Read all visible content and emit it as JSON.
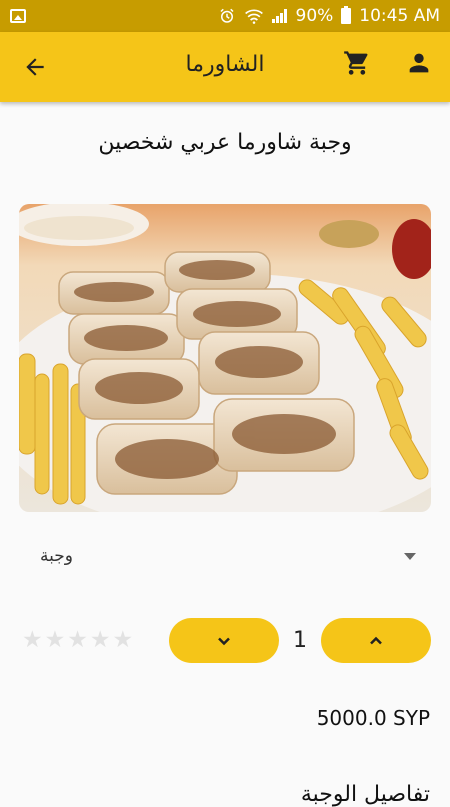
{
  "status_bar": {
    "battery_percent": "90%",
    "time": "10:45 AM",
    "left_icon": "image-icon",
    "icons": [
      "alarm-icon",
      "wifi-icon",
      "signal-icon",
      "battery-icon"
    ]
  },
  "app_bar": {
    "title": "الشاورما",
    "back_icon": "arrow-back-icon",
    "cart_icon": "cart-icon",
    "account_icon": "person-icon",
    "color": "#f5c518"
  },
  "product": {
    "title": "وجبة شاورما عربي شخصين",
    "image_alt": "shawarma-meal-photo",
    "option_selected": "وجبة",
    "rating": 0,
    "rating_max": 5,
    "quantity": "1",
    "price": "5000.0 SYP",
    "details_heading": "تفاصيل الوجبة"
  },
  "colors": {
    "accent": "#f5c518",
    "status_bar": "#c79c00",
    "star_empty": "#e2e2e2"
  }
}
